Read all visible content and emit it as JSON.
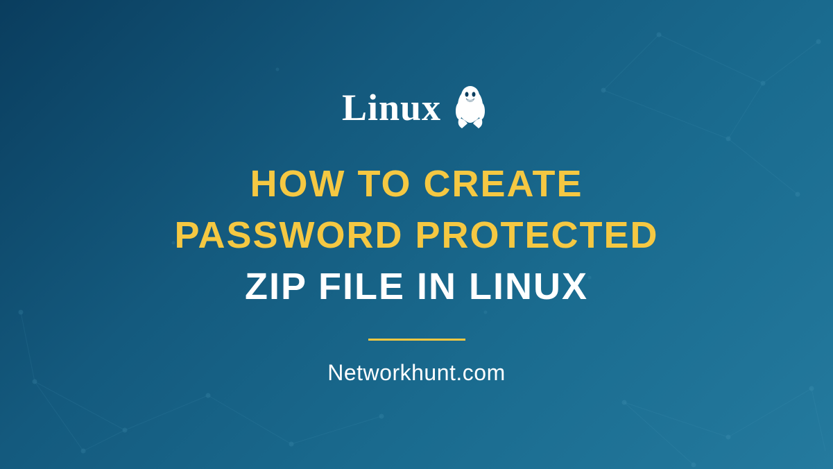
{
  "logo": {
    "text": "Linux"
  },
  "title": {
    "line1": "HOW TO CREATE",
    "line2": "PASSWORD PROTECTED",
    "line3": "ZIP FILE IN LINUX"
  },
  "website": "Networkhunt.com"
}
